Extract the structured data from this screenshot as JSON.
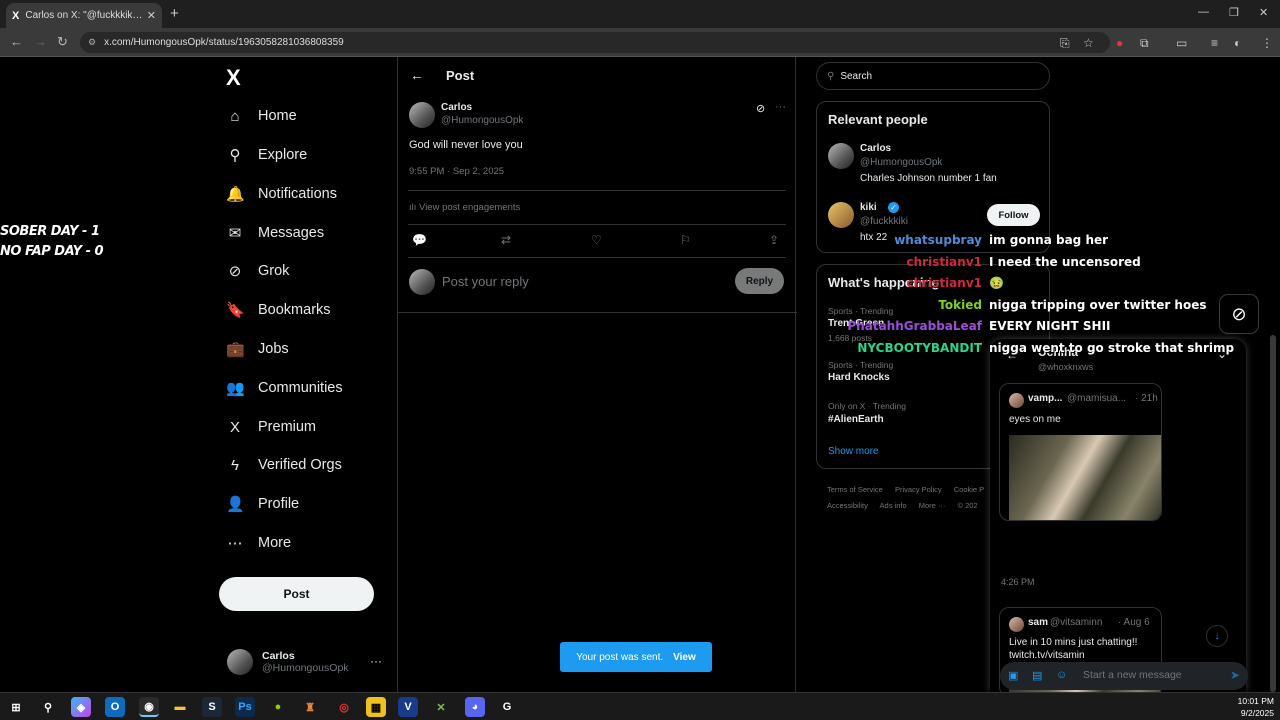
{
  "browser": {
    "tab_title": "Carlos on X: \"@fuckkkiki God w",
    "tab_logo": "X",
    "url": "x.com/HumongousOpk/status/1963058281036808359"
  },
  "overlay": {
    "sober_line1": "SOBER DAY - 1",
    "sober_line2": "NO FAP DAY - 0"
  },
  "nav": {
    "logo": "X",
    "items": [
      {
        "label": "Home",
        "icon": "home-icon",
        "glyph": "⌂"
      },
      {
        "label": "Explore",
        "icon": "search-icon",
        "glyph": "⚲"
      },
      {
        "label": "Notifications",
        "icon": "bell-icon",
        "glyph": "🔔"
      },
      {
        "label": "Messages",
        "icon": "mail-icon",
        "glyph": "✉"
      },
      {
        "label": "Grok",
        "icon": "grok-icon",
        "glyph": "⊘"
      },
      {
        "label": "Bookmarks",
        "icon": "bookmark-icon",
        "glyph": "🔖"
      },
      {
        "label": "Jobs",
        "icon": "briefcase-icon",
        "glyph": "💼"
      },
      {
        "label": "Communities",
        "icon": "people-icon",
        "glyph": "👥"
      },
      {
        "label": "Premium",
        "icon": "x-icon",
        "glyph": "X"
      },
      {
        "label": "Verified Orgs",
        "icon": "lightning-icon",
        "glyph": "ϟ"
      },
      {
        "label": "Profile",
        "icon": "person-icon",
        "glyph": "👤"
      },
      {
        "label": "More",
        "icon": "more-circle-icon",
        "glyph": "⋯"
      }
    ],
    "post_label": "Post",
    "account_name": "Carlos",
    "account_handle": "@HumongousOpk"
  },
  "main": {
    "header_title": "Post",
    "tweet": {
      "name": "Carlos",
      "handle": "@HumongousOpk",
      "text": "God will never love you",
      "time": "9:55 PM · Sep 2, 2025",
      "engagements": "View post engagements"
    },
    "reply_placeholder": "Post your reply",
    "reply_label": "Reply",
    "toast_text": "Your post was sent.",
    "toast_view": "View"
  },
  "right": {
    "search_placeholder": "Search",
    "relevant_title": "Relevant people",
    "people": [
      {
        "name": "Carlos",
        "handle": "@HumongousOpk",
        "bio": "Charles Johnson number 1 fan"
      },
      {
        "name": "kiki",
        "handle": "@fuckkkiki",
        "bio": "htx 22",
        "follow_label": "Follow"
      }
    ],
    "happening_title": "What's happening",
    "trends": [
      {
        "meta": "Sports · Trending",
        "name": "Trent Green",
        "count": "1,668 posts"
      },
      {
        "meta": "Sports · Trending",
        "name": "Hard Knocks"
      },
      {
        "meta": "Only on X · Trending",
        "name": "#AlienEarth"
      }
    ],
    "show_more": "Show more",
    "footer": [
      "Terms of Service",
      "Privacy Policy",
      "Cookie P",
      "Accessibility",
      "Ads info",
      "More ···",
      "© 202"
    ]
  },
  "chat": [
    {
      "user": "whatsupbray",
      "color": "#4f8bd6",
      "msg": "im gonna bag her"
    },
    {
      "user": "christianv1",
      "color": "#d02a40",
      "msg": "I need the uncensored"
    },
    {
      "user": "christianv1",
      "color": "#d02a40",
      "msg": "🤢"
    },
    {
      "user": "Tokied",
      "color": "#7ed321",
      "msg": "nigga tripping over twitter hoes"
    },
    {
      "user": "PhatahhGrabbaLeaf",
      "color": "#9b4fd6",
      "msg": "EVERY NIGHT SHII"
    },
    {
      "user": "NYCBOOTYBANDIT",
      "color": "#2ad68a",
      "msg": "nigga went to go stroke that shrimp"
    }
  ],
  "dm": {
    "title": "Uchiha",
    "handle": "@whoxknxws",
    "cards": [
      {
        "name": "vamp...",
        "handle": "@mamisua...",
        "age": "· 21h",
        "text": "eyes on me"
      },
      {
        "name": "sam",
        "handle": "@vitsaminn",
        "age": "· Aug 6",
        "text": "Live in 10 mins just chatting!!",
        "text2": "twitch.tv/vitsamin"
      }
    ],
    "time": "4:26 PM",
    "compose_placeholder": "Start a new message"
  },
  "taskbar": {
    "time": "10:01 PM",
    "date": "9/2/2025"
  }
}
